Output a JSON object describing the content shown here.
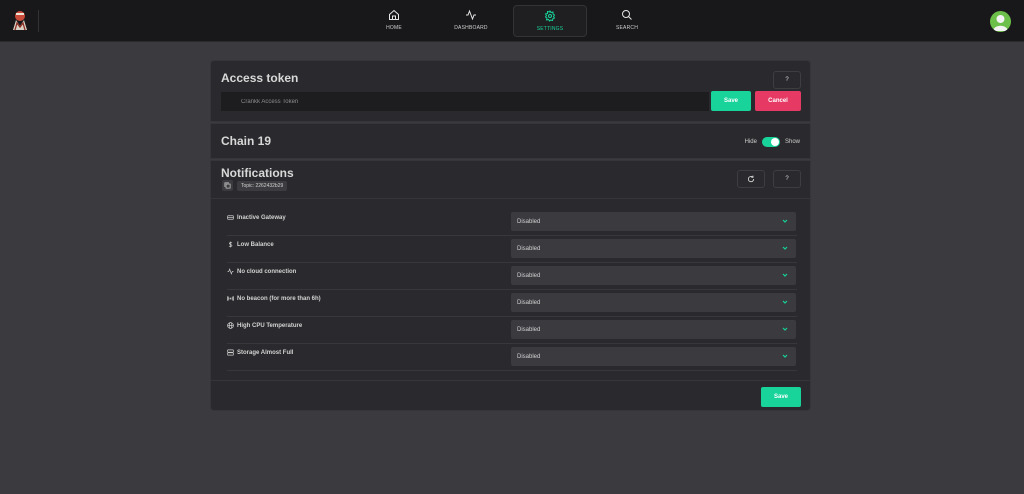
{
  "nav": {
    "items": [
      {
        "label": "HOME",
        "icon": "home-icon"
      },
      {
        "label": "DASHBOARD",
        "icon": "activity-icon"
      },
      {
        "label": "SETTINGS",
        "icon": "gear-icon",
        "active": true
      },
      {
        "label": "SEARCH",
        "icon": "search-icon"
      }
    ]
  },
  "access_token": {
    "title": "Access token",
    "help_label": "?",
    "placeholder": "Crankk Access Token",
    "save_label": "Save",
    "cancel_label": "Cancel"
  },
  "chain": {
    "title": "Chain 19",
    "hide_label": "Hide",
    "show_label": "Show",
    "toggle_on": true
  },
  "notifications": {
    "title": "Notifications",
    "topic": "Topic: 2262432b29",
    "help_label": "?",
    "rows": [
      {
        "label": "Inactive Gateway",
        "icon": "gateway-icon",
        "value": "Disabled"
      },
      {
        "label": "Low Balance",
        "icon": "dollar-icon",
        "value": "Disabled"
      },
      {
        "label": "No cloud connection",
        "icon": "activity-icon",
        "value": "Disabled"
      },
      {
        "label": "No beacon (for more than 6h)",
        "icon": "broadcast-icon",
        "value": "Disabled"
      },
      {
        "label": "High CPU Temperature",
        "icon": "globe-icon",
        "value": "Disabled"
      },
      {
        "label": "Storage Almost Full",
        "icon": "storage-icon",
        "value": "Disabled"
      }
    ],
    "save_label": "Save"
  },
  "colors": {
    "accent": "#18d39a",
    "danger": "#e63a65",
    "background": "#3b3b3f",
    "card": "#2a2a2e",
    "topbar": "#18181a"
  }
}
